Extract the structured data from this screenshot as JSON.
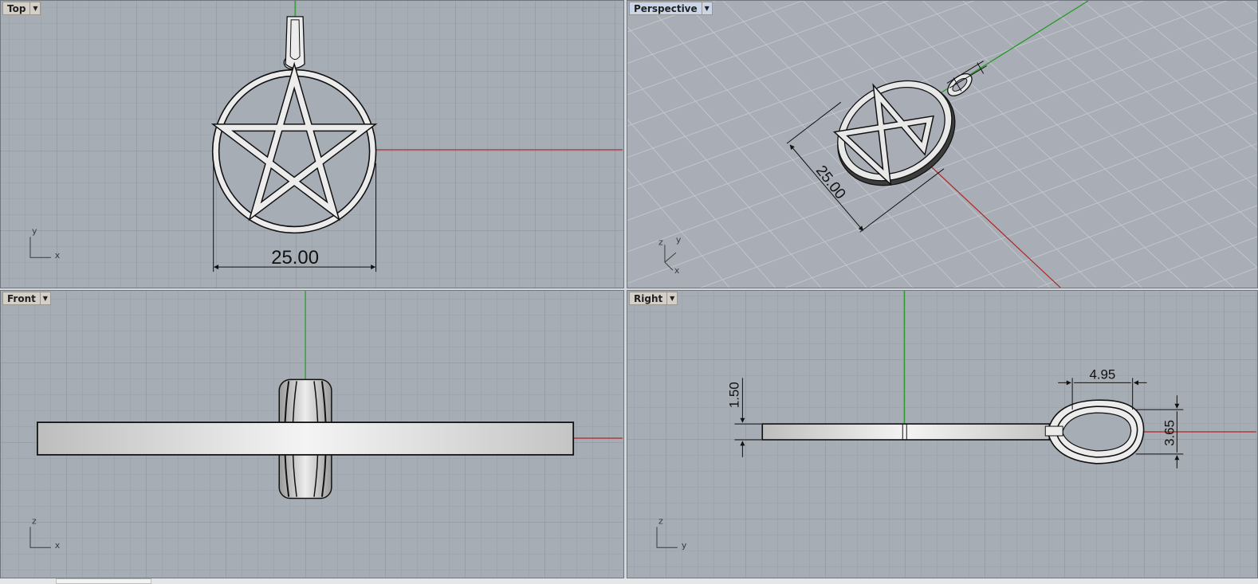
{
  "viewports": {
    "top": {
      "label": "Top",
      "dimension": "25.00",
      "axis_vertical": "y",
      "axis_horizontal": "x"
    },
    "perspective": {
      "label": "Perspective",
      "dimension": "25.00",
      "axis_z": "z",
      "axis_y": "y",
      "axis_x": "x"
    },
    "front": {
      "label": "Front",
      "axis_vertical": "z",
      "axis_horizontal": "x"
    },
    "right": {
      "label": "Right",
      "dim_thickness": "1.50",
      "dim_bail_width": "4.95",
      "dim_bail_height": "3.65",
      "axis_vertical": "z",
      "axis_horizontal": "y"
    }
  },
  "active_viewport": "perspective",
  "colors": {
    "viewport_bg": "#a7adb5",
    "grid_minor": "#9aa1a9",
    "grid_major": "#8a9199",
    "x_axis": "#b22222",
    "y_axis": "#1e9a1e",
    "object_fill": "#eeeeee",
    "object_outline": "#111111",
    "dimension_line": "#111111"
  },
  "icons": {
    "viewport_menu": "dropdown-arrow-icon",
    "axes": "axis-triad-icon"
  }
}
